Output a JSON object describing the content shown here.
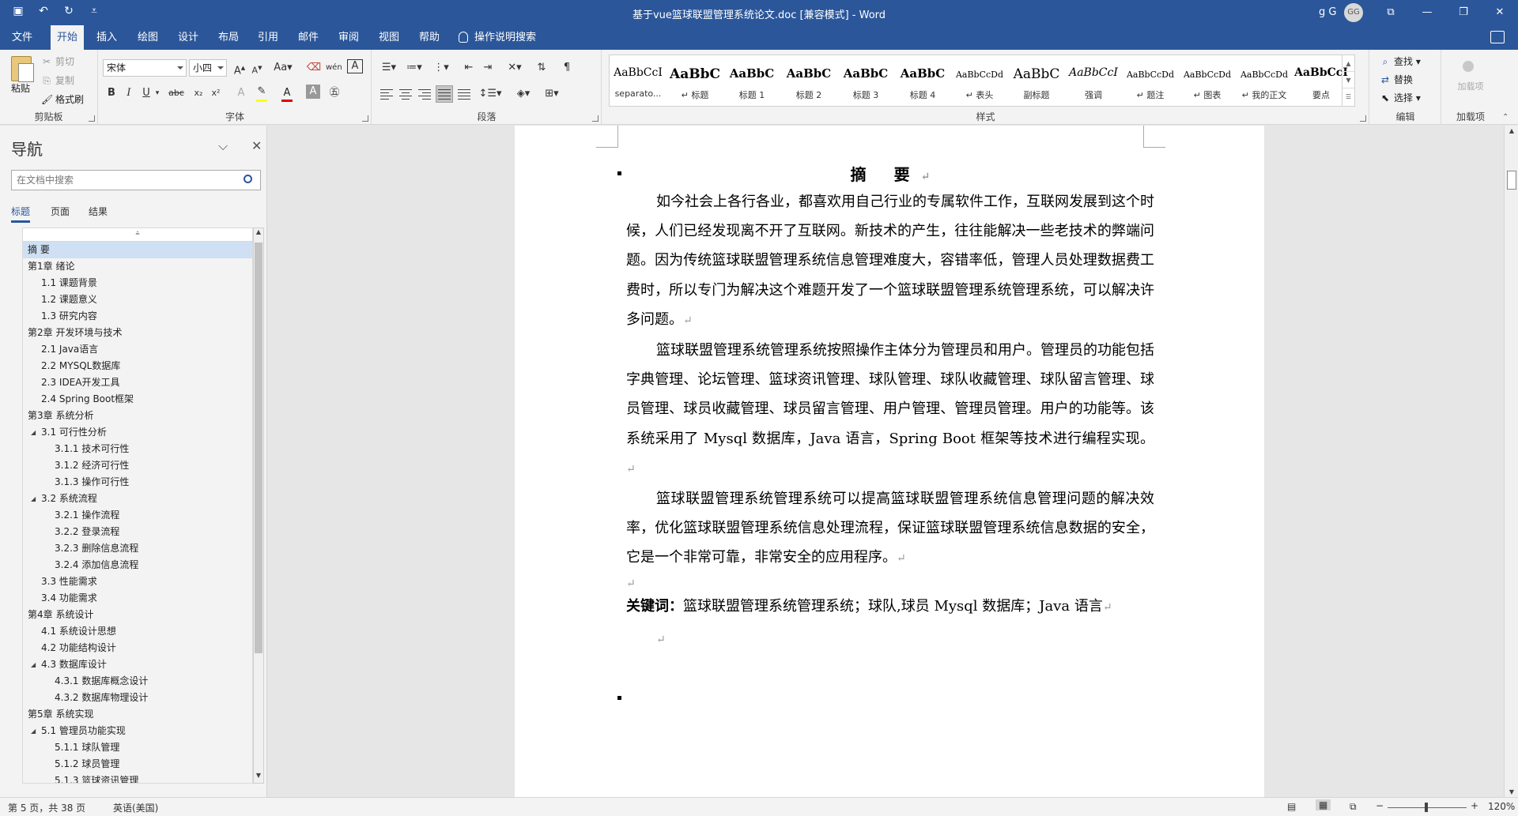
{
  "window": {
    "title": "基于vue篮球联盟管理系统论文.doc [兼容模式]  -  Word",
    "user_name": "g G",
    "avatar_initials": "GG"
  },
  "tabs": [
    "文件",
    "开始",
    "插入",
    "绘图",
    "设计",
    "布局",
    "引用",
    "邮件",
    "审阅",
    "视图",
    "帮助"
  ],
  "active_tab": "开始",
  "tell_me": "操作说明搜索",
  "clipboard": {
    "paste": "粘贴",
    "cut": "剪切",
    "copy": "复制",
    "format_painter": "格式刷",
    "label": "剪贴板"
  },
  "font": {
    "name": "宋体",
    "size": "小四",
    "label": "字体",
    "case_button": "Aa",
    "bold": "B",
    "italic": "I",
    "underline": "U",
    "strike": "abc",
    "subscript": "x₂",
    "superscript": "x²",
    "font_color_letter": "A",
    "highlight_color": "#ffff00",
    "font_color": "#e00000"
  },
  "paragraph": {
    "label": "段落"
  },
  "styles": {
    "label": "样式",
    "items": [
      {
        "sample": "AaBbCcI",
        "name": "separato..."
      },
      {
        "sample": "AaBbC",
        "name": "↵ 标题"
      },
      {
        "sample": "AaBbC",
        "name": "标题 1"
      },
      {
        "sample": "AaBbC",
        "name": "标题 2"
      },
      {
        "sample": "AaBbC",
        "name": "标题 3"
      },
      {
        "sample": "AaBbC",
        "name": "标题 4"
      },
      {
        "sample": "AaBbCcDd",
        "name": "↵ 表头"
      },
      {
        "sample": "AaBbC",
        "name": "副标题"
      },
      {
        "sample": "AaBbCcI",
        "name": "强调"
      },
      {
        "sample": "AaBbCcDd",
        "name": "↵ 题注"
      },
      {
        "sample": "AaBbCcDd",
        "name": "↵ 图表"
      },
      {
        "sample": "AaBbCcDd",
        "name": "↵ 我的正文"
      },
      {
        "sample": "AaBbCcI",
        "name": "要点"
      }
    ]
  },
  "editing": {
    "find": "查找",
    "replace": "替换",
    "select": "选择",
    "label": "编辑"
  },
  "addins": {
    "button": "加载项",
    "label": "加载项"
  },
  "nav": {
    "title": "导航",
    "search_placeholder": "在文档中搜索",
    "tabs": [
      "标题",
      "页面",
      "结果"
    ],
    "active_tab": "标题",
    "items": [
      {
        "label": "摘  要",
        "level": 0,
        "expand": "",
        "selected": true
      },
      {
        "label": "第1章 绪论",
        "level": 0,
        "expand": "◢"
      },
      {
        "label": "1.1 课题背景",
        "level": 1,
        "expand": ""
      },
      {
        "label": "1.2 课题意义",
        "level": 1,
        "expand": ""
      },
      {
        "label": "1.3 研究内容",
        "level": 1,
        "expand": ""
      },
      {
        "label": "第2章 开发环境与技术",
        "level": 0,
        "expand": "◢"
      },
      {
        "label": "2.1 Java语言",
        "level": 1,
        "expand": ""
      },
      {
        "label": "2.2 MYSQL数据库",
        "level": 1,
        "expand": ""
      },
      {
        "label": "2.3 IDEA开发工具",
        "level": 1,
        "expand": ""
      },
      {
        "label": "2.4 Spring Boot框架",
        "level": 1,
        "expand": ""
      },
      {
        "label": "第3章 系统分析",
        "level": 0,
        "expand": "◢"
      },
      {
        "label": "3.1 可行性分析",
        "level": 1,
        "expand": "◢"
      },
      {
        "label": "3.1.1 技术可行性",
        "level": 2,
        "expand": ""
      },
      {
        "label": "3.1.2 经济可行性",
        "level": 2,
        "expand": ""
      },
      {
        "label": "3.1.3 操作可行性",
        "level": 2,
        "expand": ""
      },
      {
        "label": "3.2 系统流程",
        "level": 1,
        "expand": "◢"
      },
      {
        "label": "3.2.1 操作流程",
        "level": 2,
        "expand": ""
      },
      {
        "label": "3.2.2 登录流程",
        "level": 2,
        "expand": ""
      },
      {
        "label": "3.2.3 删除信息流程",
        "level": 2,
        "expand": ""
      },
      {
        "label": "3.2.4 添加信息流程",
        "level": 2,
        "expand": ""
      },
      {
        "label": "3.3 性能需求",
        "level": 1,
        "expand": ""
      },
      {
        "label": "3.4 功能需求",
        "level": 1,
        "expand": ""
      },
      {
        "label": "第4章 系统设计",
        "level": 0,
        "expand": "◢"
      },
      {
        "label": "4.1 系统设计思想",
        "level": 1,
        "expand": ""
      },
      {
        "label": "4.2 功能结构设计",
        "level": 1,
        "expand": ""
      },
      {
        "label": "4.3 数据库设计",
        "level": 1,
        "expand": "◢"
      },
      {
        "label": "4.3.1 数据库概念设计",
        "level": 2,
        "expand": ""
      },
      {
        "label": "4.3.2 数据库物理设计",
        "level": 2,
        "expand": ""
      },
      {
        "label": "第5章 系统实现",
        "level": 0,
        "expand": "◢"
      },
      {
        "label": "5.1 管理员功能实现",
        "level": 1,
        "expand": "◢"
      },
      {
        "label": "5.1.1 球队管理",
        "level": 2,
        "expand": ""
      },
      {
        "label": "5.1.2 球员管理",
        "level": 2,
        "expand": ""
      },
      {
        "label": "5.1.3 篮球资讯管理",
        "level": 2,
        "expand": ""
      }
    ]
  },
  "document": {
    "heading": "摘 要",
    "paragraphs": [
      "如今社会上各行各业，都喜欢用自己行业的专属软件工作，互联网发展到这个时候，人们已经发现离不开了互联网。新技术的产生，往往能解决一些老技术的弊端问题。因为传统篮球联盟管理系统信息管理难度大，容错率低，管理人员处理数据费工费时，所以专门为解决这个难题开发了一个篮球联盟管理系统管理系统，可以解决许多问题。",
      "篮球联盟管理系统管理系统按照操作主体分为管理员和用户。管理员的功能包括字典管理、论坛管理、篮球资讯管理、球队管理、球队收藏管理、球队留言管理、球员管理、球员收藏管理、球员留言管理、用户管理、管理员管理。用户的功能等。该系统采用了 Mysql 数据库，Java 语言，Spring Boot 框架等技术进行编程实现。",
      "篮球联盟管理系统管理系统可以提高篮球联盟管理系统信息管理问题的解决效率，优化篮球联盟管理系统信息处理流程，保证篮球联盟管理系统信息数据的安全，它是一个非常可靠，非常安全的应用程序。"
    ],
    "keywords_label": "关键词：",
    "keywords": "篮球联盟管理系统管理系统；球队,球员 Mysql 数据库；Java 语言",
    "para_mark": "↵"
  },
  "status": {
    "page": "第 5 页，共 38 页",
    "language": "英语(美国)",
    "zoom": "120%",
    "zoom_minus": "−",
    "zoom_plus": "+"
  }
}
